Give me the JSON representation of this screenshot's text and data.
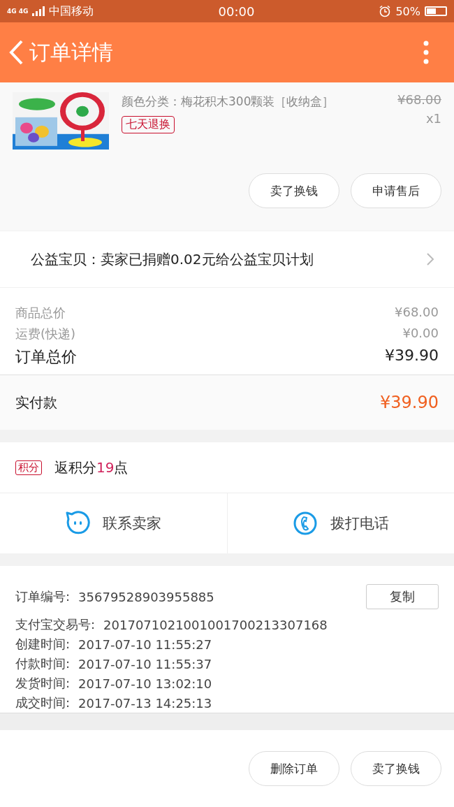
{
  "status_bar": {
    "carrier": "中国移动",
    "network": "4G 4G",
    "time": "00:00",
    "battery": "50%"
  },
  "header": {
    "title": "订单详情"
  },
  "product": {
    "variant": "颜色分类：梅花积木300颗装［收纳盒］",
    "badge": "七天退换",
    "original_price": "¥68.00",
    "quantity": "x1",
    "actions": [
      "卖了换钱",
      "申请售后"
    ]
  },
  "charity": {
    "text": "公益宝贝：卖家已捐赠0.02元给公益宝贝计划"
  },
  "summary": [
    {
      "label": "商品总价",
      "value": "¥68.00",
      "kind": "minor"
    },
    {
      "label": "运费(快递)",
      "value": "¥0.00",
      "kind": "minor"
    },
    {
      "label": "订单总价",
      "value": "¥39.90",
      "kind": "total"
    }
  ],
  "paid": {
    "label": "实付款",
    "value": "¥39.90"
  },
  "points": {
    "badge": "积分",
    "text": "返积分**19**点"
  },
  "contact": [
    {
      "label": "联系卖家",
      "kind": "chat"
    },
    {
      "label": "拨打电话",
      "kind": "phone"
    }
  ],
  "order_info": {
    "copy_button": "复制",
    "rows": [
      {
        "label": "订单编号:",
        "value": "35679528903955885"
      },
      {
        "label": "支付宝交易号:",
        "value": "2017071021001001700213307168"
      },
      {
        "label": "创建时间:",
        "value": "2017-07-10 11:55:27"
      },
      {
        "label": "付款时间:",
        "value": "2017-07-10 11:55:37"
      },
      {
        "label": "发货时间:",
        "value": "2017-07-10 13:02:10"
      },
      {
        "label": "成交时间:",
        "value": "2017-07-13 14:25:13"
      }
    ]
  },
  "bottom_actions": [
    "删除订单",
    "卖了换钱"
  ]
}
